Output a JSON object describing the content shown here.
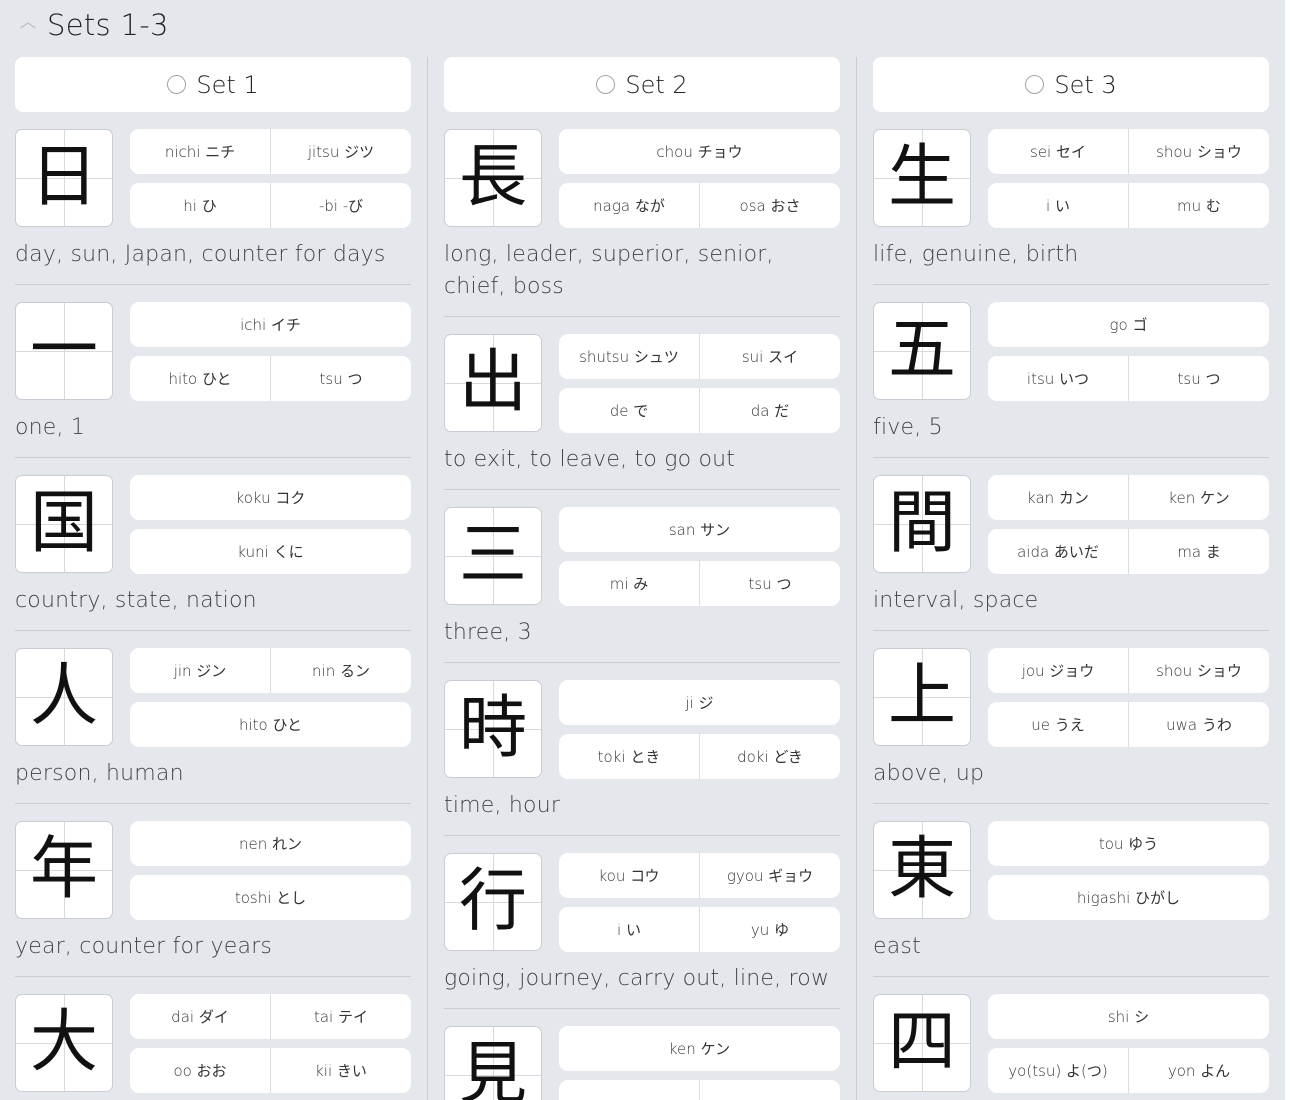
{
  "section": {
    "title": "Sets 1-3",
    "collapse_icon": "chevron-up-icon"
  },
  "columns": [
    {
      "set_label": "Set 1",
      "entries": [
        {
          "kanji": "日",
          "readings": [
            [
              "nichi ニチ",
              "jitsu ジツ"
            ],
            [
              "hi ひ",
              "-bi -び"
            ]
          ],
          "meaning": "day, sun, Japan, counter for days"
        },
        {
          "kanji": "一",
          "readings": [
            [
              "ichi イチ"
            ],
            [
              "hito ひと",
              "tsu つ"
            ]
          ],
          "meaning": "one, 1"
        },
        {
          "kanji": "国",
          "readings": [
            [
              "koku コク"
            ],
            [
              "kuni くに"
            ]
          ],
          "meaning": "country, state, nation"
        },
        {
          "kanji": "人",
          "readings": [
            [
              "jin ジン",
              "nin るン"
            ],
            [
              "hito ひと"
            ]
          ],
          "meaning": "person, human"
        },
        {
          "kanji": "年",
          "readings": [
            [
              "nen れン"
            ],
            [
              "toshi とし"
            ]
          ],
          "meaning": "year, counter for years"
        },
        {
          "kanji": "大",
          "readings": [
            [
              "dai ダイ",
              "tai テイ"
            ],
            [
              "oo おお",
              "kii きい"
            ]
          ],
          "meaning": ""
        }
      ]
    },
    {
      "set_label": "Set 2",
      "entries": [
        {
          "kanji": "長",
          "readings": [
            [
              "chou チョウ"
            ],
            [
              "naga なが",
              "osa おさ"
            ]
          ],
          "meaning": "long, leader, superior, senior, chief, boss"
        },
        {
          "kanji": "出",
          "readings": [
            [
              "shutsu シュツ",
              "sui スイ"
            ],
            [
              "de で",
              "da だ"
            ]
          ],
          "meaning": "to exit, to leave, to go out"
        },
        {
          "kanji": "三",
          "readings": [
            [
              "san サン"
            ],
            [
              "mi み",
              "tsu つ"
            ]
          ],
          "meaning": "three, 3"
        },
        {
          "kanji": "時",
          "readings": [
            [
              "ji ジ"
            ],
            [
              "toki とき",
              "doki どき"
            ]
          ],
          "meaning": "time, hour"
        },
        {
          "kanji": "行",
          "readings": [
            [
              "kou コウ",
              "gyou ギョウ"
            ],
            [
              "i い",
              "yu ゆ"
            ]
          ],
          "meaning": "going, journey, carry out, line, row"
        },
        {
          "kanji": "見",
          "readings": [
            [
              "ken ケン"
            ],
            [
              "",
              ""
            ]
          ],
          "meaning": ""
        }
      ]
    },
    {
      "set_label": "Set 3",
      "entries": [
        {
          "kanji": "生",
          "readings": [
            [
              "sei セイ",
              "shou ショウ"
            ],
            [
              "i い",
              "mu む"
            ]
          ],
          "meaning": "life, genuine, birth"
        },
        {
          "kanji": "五",
          "readings": [
            [
              "go ゴ"
            ],
            [
              "itsu いつ",
              "tsu つ"
            ]
          ],
          "meaning": "five, 5"
        },
        {
          "kanji": "間",
          "readings": [
            [
              "kan カン",
              "ken ケン"
            ],
            [
              "aida あいだ",
              "ma ま"
            ]
          ],
          "meaning": "interval, space"
        },
        {
          "kanji": "上",
          "readings": [
            [
              "jou ジョウ",
              "shou ショウ"
            ],
            [
              "ue うえ",
              "uwa うわ"
            ]
          ],
          "meaning": "above, up"
        },
        {
          "kanji": "東",
          "readings": [
            [
              "tou ゆう"
            ],
            [
              "higashi ひがし"
            ]
          ],
          "meaning": "east"
        },
        {
          "kanji": "四",
          "readings": [
            [
              "shi シ"
            ],
            [
              "yo(tsu) よ(つ)",
              "yon よん"
            ]
          ],
          "meaning": ""
        }
      ]
    }
  ]
}
